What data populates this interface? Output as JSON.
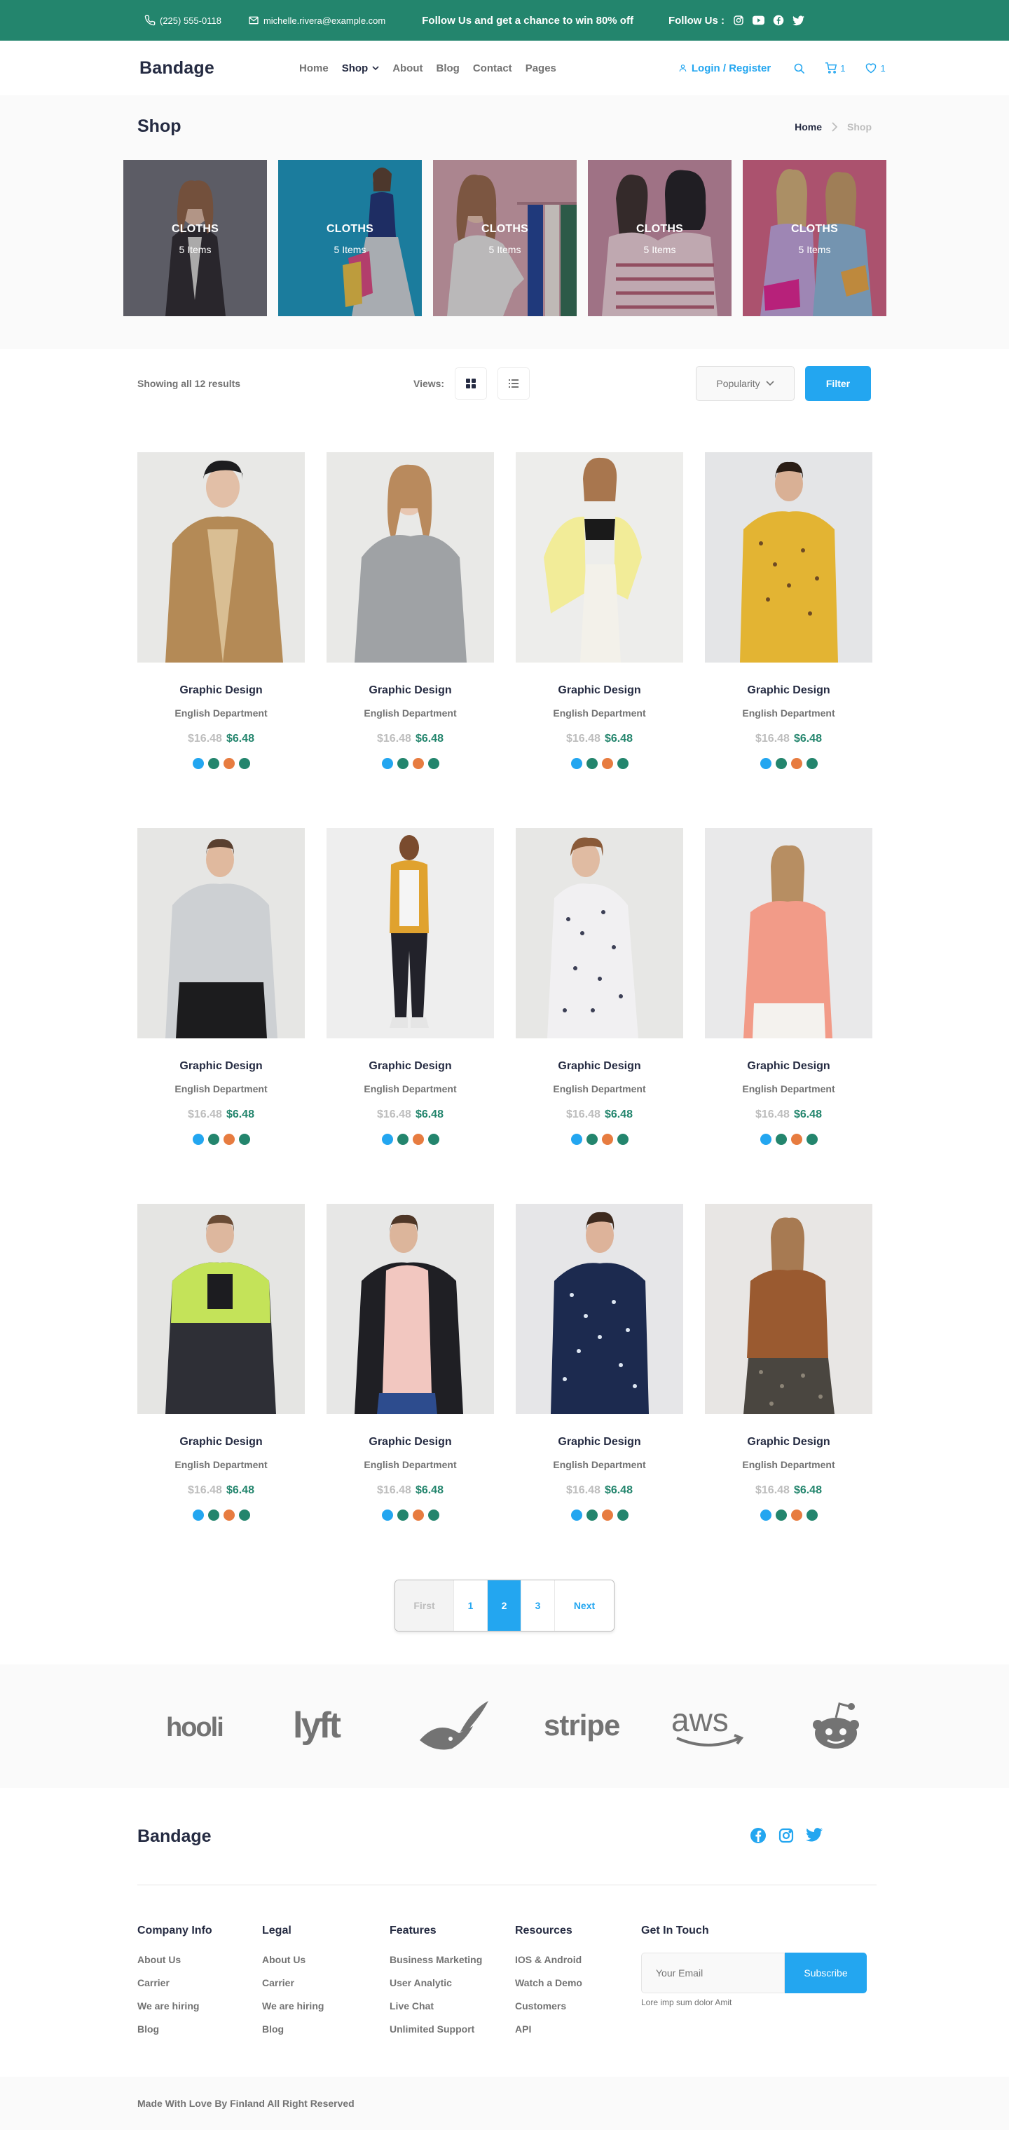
{
  "topbar": {
    "phone": "(225) 555-0118",
    "email": "michelle.rivera@example.com",
    "promo": "Follow Us  and get a chance to win 80% off",
    "follow_label": "Follow Us  :"
  },
  "nav": {
    "brand": "Bandage",
    "items": [
      "Home",
      "Shop",
      "About",
      "Blog",
      "Contact",
      "Pages"
    ],
    "login": "Login / Register",
    "cart_count": "1",
    "wishlist_count": "1"
  },
  "shop": {
    "title": "Shop",
    "breadcrumb_home": "Home",
    "breadcrumb_current": "Shop",
    "categories": [
      {
        "title": "CLOTHS",
        "count": "5 Items"
      },
      {
        "title": "CLOTHS",
        "count": "5 Items"
      },
      {
        "title": "CLOTHS",
        "count": "5 Items"
      },
      {
        "title": "CLOTHS",
        "count": "5 Items"
      },
      {
        "title": "CLOTHS",
        "count": "5 Items"
      }
    ]
  },
  "filters": {
    "results": "Showing all 12 results",
    "views_label": "Views:",
    "sort": "Popularity",
    "filter_button": "Filter"
  },
  "products": [
    {
      "title": "Graphic Design",
      "dept": "English Department",
      "old_price": "$16.48",
      "price": "$6.48"
    },
    {
      "title": "Graphic Design",
      "dept": "English Department",
      "old_price": "$16.48",
      "price": "$6.48"
    },
    {
      "title": "Graphic Design",
      "dept": "English Department",
      "old_price": "$16.48",
      "price": "$6.48"
    },
    {
      "title": "Graphic Design",
      "dept": "English Department",
      "old_price": "$16.48",
      "price": "$6.48"
    },
    {
      "title": "Graphic Design",
      "dept": "English Department",
      "old_price": "$16.48",
      "price": "$6.48"
    },
    {
      "title": "Graphic Design",
      "dept": "English Department",
      "old_price": "$16.48",
      "price": "$6.48"
    },
    {
      "title": "Graphic Design",
      "dept": "English Department",
      "old_price": "$16.48",
      "price": "$6.48"
    },
    {
      "title": "Graphic Design",
      "dept": "English Department",
      "old_price": "$16.48",
      "price": "$6.48"
    },
    {
      "title": "Graphic Design",
      "dept": "English Department",
      "old_price": "$16.48",
      "price": "$6.48"
    },
    {
      "title": "Graphic Design",
      "dept": "English Department",
      "old_price": "$16.48",
      "price": "$6.48"
    },
    {
      "title": "Graphic Design",
      "dept": "English Department",
      "old_price": "$16.48",
      "price": "$6.48"
    },
    {
      "title": "Graphic Design",
      "dept": "English Department",
      "old_price": "$16.48",
      "price": "$6.48"
    }
  ],
  "swatch_colors": [
    "#23A6F0",
    "#23856D",
    "#E77C40",
    "#252B42"
  ],
  "pagination": {
    "first": "First",
    "pages": [
      "1",
      "2",
      "3"
    ],
    "active": "2",
    "next": "Next"
  },
  "logos": [
    "hooli",
    "lyft",
    "pied-piper",
    "stripe",
    "aws",
    "reddit"
  ],
  "footer": {
    "brand": "Bandage",
    "columns": [
      {
        "title": "Company Info",
        "links": [
          "About Us",
          "Carrier",
          "We are hiring",
          "Blog"
        ]
      },
      {
        "title": "Legal",
        "links": [
          "About Us",
          "Carrier",
          "We are hiring",
          "Blog"
        ]
      },
      {
        "title": "Features",
        "links": [
          "Business Marketing",
          "User Analytic",
          "Live Chat",
          "Unlimited Support"
        ]
      },
      {
        "title": "Resources",
        "links": [
          "IOS & Android",
          "Watch a Demo",
          "Customers",
          "API"
        ]
      }
    ],
    "newsletter_title": "Get In Touch",
    "email_placeholder": "Your Email",
    "subscribe": "Subscribe",
    "note": "Lore imp sum dolor Amit",
    "copyright": "Made With Love By Finland All Right Reserved"
  },
  "colors": {
    "primary": "#23A6F0",
    "green": "#23856D",
    "dark": "#252B42",
    "muted": "#737373"
  }
}
